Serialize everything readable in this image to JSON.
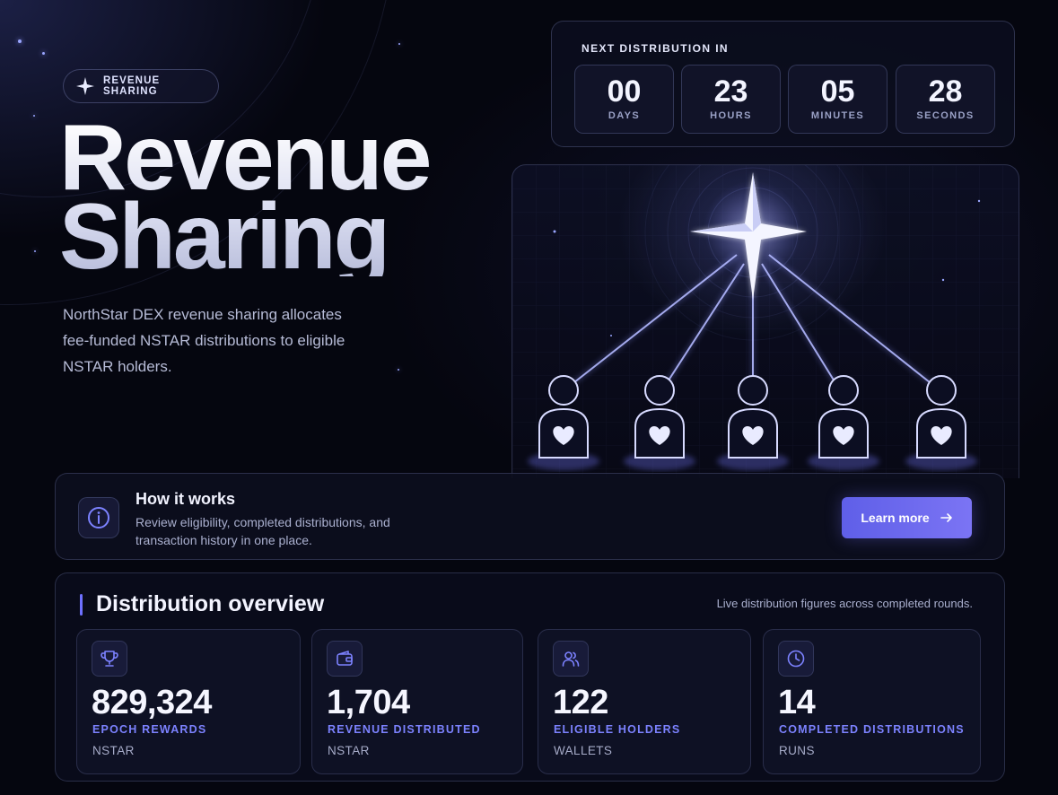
{
  "badge": {
    "label": "REVENUE SHARING",
    "icon": "four-point-star-icon"
  },
  "hero": {
    "title_line1": "Revenue",
    "title_line2": "Sharing",
    "description": "NorthStar DEX revenue sharing allocates fee-funded NSTAR distributions to eligible NSTAR holders."
  },
  "countdown": {
    "label": "NEXT DISTRIBUTION IN",
    "units": [
      {
        "value": "00",
        "unit": "DAYS"
      },
      {
        "value": "23",
        "unit": "HOURS"
      },
      {
        "value": "05",
        "unit": "MINUTES"
      },
      {
        "value": "28",
        "unit": "SECONDS"
      }
    ]
  },
  "illustration": {
    "icon": "northstar-distribution-graphic",
    "recipients": 5
  },
  "how_it_works": {
    "icon": "info-icon",
    "title": "How it works",
    "description": "Review eligibility, completed distributions, and transaction history in one place.",
    "button_label": "Learn more",
    "button_icon": "arrow-right-icon"
  },
  "overview": {
    "title": "Distribution overview",
    "subtitle": "Live distribution figures across completed rounds.",
    "stats": [
      {
        "icon": "trophy-icon",
        "value": "829,324",
        "label": "EPOCH REWARDS",
        "unit": "NSTAR"
      },
      {
        "icon": "wallet-icon",
        "value": "1,704",
        "label": "REVENUE DISTRIBUTED",
        "unit": "NSTAR"
      },
      {
        "icon": "users-icon",
        "value": "122",
        "label": "ELIGIBLE HOLDERS",
        "unit": "WALLETS"
      },
      {
        "icon": "clock-icon",
        "value": "14",
        "label": "COMPLETED DISTRIBUTIONS",
        "unit": "RUNS"
      }
    ]
  },
  "colors": {
    "accent": "#6e70ff",
    "button": "#6b66ee",
    "background": "#05060f"
  }
}
